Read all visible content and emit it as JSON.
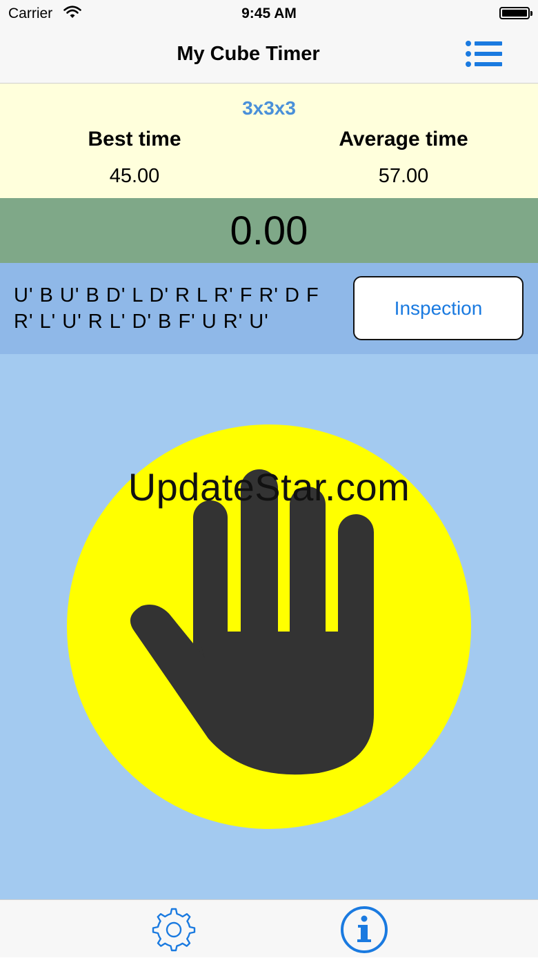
{
  "status_bar": {
    "carrier": "Carrier",
    "time": "9:45 AM"
  },
  "nav": {
    "title": "My Cube Timer",
    "list_icon": "list-icon"
  },
  "stats": {
    "puzzle_type": "3x3x3",
    "best_label": "Best time",
    "best_value": "45.00",
    "average_label": "Average time",
    "average_value": "57.00"
  },
  "timer": {
    "value": "0.00"
  },
  "scramble": {
    "line1": "U' B U' B D' L D' R L R' F R' D F",
    "line2": "R' L' U' R L' D' B F' U R' U'",
    "inspection_label": "Inspection"
  },
  "touch_area": {
    "icon": "stop-hand-icon",
    "watermark": "UpdateStar.com"
  },
  "tab_bar": {
    "settings_icon": "gear-icon",
    "info_icon": "info-icon"
  },
  "colors": {
    "accent": "#1a7ae0",
    "stats_bg": "#ffffdc",
    "timer_bg": "#7fa888",
    "scramble_bg": "#8fb8e8",
    "touch_bg": "#a3caf0",
    "circle": "#ffff00",
    "hand": "#333333"
  }
}
